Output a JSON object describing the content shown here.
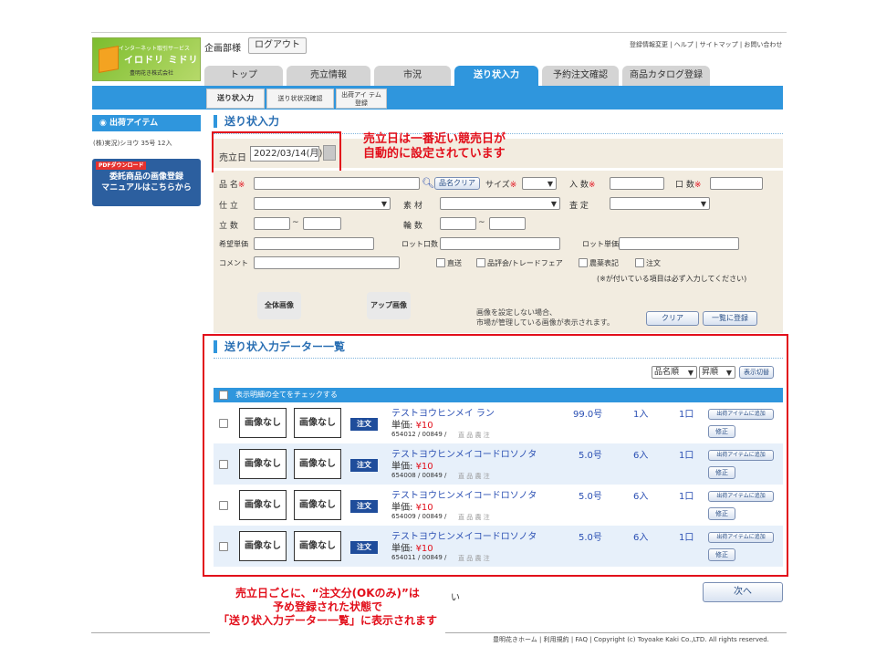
{
  "logo": {
    "line1": "インターネット取引サービス",
    "line2": "イロドリ ミドリ",
    "line3": "豊明花き株式会社"
  },
  "header": {
    "user_label": "企画部様",
    "logout": "ログアウト",
    "links": "登録情報変更 | ヘルプ | サイトマップ | お問い合わせ"
  },
  "tabs": [
    "トップ",
    "売立情報",
    "市況",
    "送り状入力",
    "予約注文確認",
    "商品カタログ登録"
  ],
  "subtabs": [
    "送り状入力",
    "送り状状況確認",
    "出荷アイ テム登録"
  ],
  "sidebar": {
    "heading": "出荷アイテム",
    "text": "(株)実況)シヨウ 35号 12入",
    "pdf_tag": "PDFダウンロード",
    "pdf_line1": "委託商品の画像登録",
    "pdf_line2": "マニュアルはこちらから"
  },
  "form": {
    "title": "送り状入力",
    "date_label": "売立日",
    "date_value": "2022/03/14(月)",
    "product_name": "品 名",
    "name_clear": "品名クリア",
    "size": "サイズ",
    "count_in": "入 数",
    "count_box": "口 数",
    "shiwake": "仕 立",
    "material": "素 材",
    "assess": "査 定",
    "stand": "立 数",
    "wheels": "輪 数",
    "hope_price": "希望単価",
    "lot_count": "ロット口数",
    "lot_price": "ロット単価",
    "comment": "コメント",
    "checks": [
      "直送",
      "品評会/トレードフェア",
      "農薬表記",
      "注文"
    ],
    "required_note": "(※が付いている項目は必ず入力してください)",
    "photo1": "全体画像",
    "photo2": "アップ画像",
    "photo_note1": "画像を設定しない場合、",
    "photo_note2": "市場が管理している画像が表示されます。",
    "clear_btn": "クリア",
    "register_btn": "一覧に登録"
  },
  "list": {
    "title": "送り状入力データー一覧",
    "sort1": "品名順",
    "sort2": "昇順",
    "sort_btn": "表示切替",
    "check_all": "表示明細の全てをチェックする",
    "no_image": "画像なし",
    "order": "注文",
    "price_label": "単価:",
    "add_btn": "出荷アイテムに追加",
    "fix_btn": "修正",
    "row_checks": "直 品 農 注",
    "rows": [
      {
        "name": "テストヨウヒンメイ ラン",
        "price": "¥10",
        "code": "654012 / 00849 /",
        "size": "99.0号",
        "qty": "1入",
        "boxes": "1口"
      },
      {
        "name": "テストヨウヒンメイコードロソノタ",
        "price": "¥10",
        "code": "654008 / 00849 /",
        "size": "5.0号",
        "qty": "6入",
        "boxes": "1口"
      },
      {
        "name": "テストヨウヒンメイコードロソノタ",
        "price": "¥10",
        "code": "654009 / 00849 /",
        "size": "5.0号",
        "qty": "6入",
        "boxes": "1口"
      },
      {
        "name": "テストヨウヒンメイコードロソノタ",
        "price": "¥10",
        "code": "654011 / 00849 /",
        "size": "5.0号",
        "qty": "6入",
        "boxes": "1口"
      }
    ],
    "next": "次へ"
  },
  "annotations": {
    "date_note1": "売立日は一番近い競売日が",
    "date_note2": "自動的に設定されています",
    "list_note1": "売立日ごとに、“注文分(OKのみ)”は",
    "list_note2": "予め登録された状態で",
    "list_note3": "「送り状入力データー一覧」に表示されます",
    "stray": "い"
  },
  "footer": "豊明花きホーム | 利用規約 | FAQ | Copyright (c) Toyoake Kaki Co.,LTD. All rights reserved.",
  "colors": {
    "accent": "#2f96dd",
    "annotation": "#e20f1b",
    "order": "#1f4d9b"
  }
}
